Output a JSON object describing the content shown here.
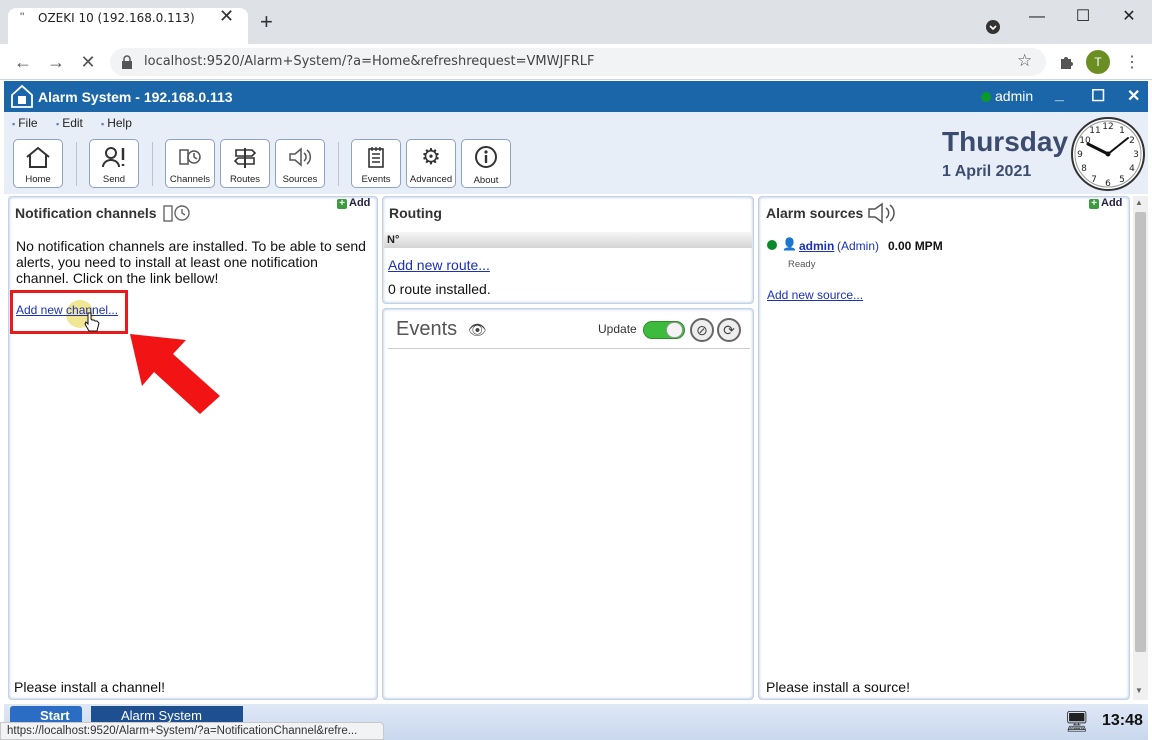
{
  "browser": {
    "tab_title": "OZEKI 10 (192.168.0.113)",
    "tab_favicon": "\"",
    "tab_close": "✕",
    "new_tab": "+",
    "url": "localhost:9520/Alarm+System/?a=Home&refreshrequest=VMWJFRLF",
    "profile_initial": "T",
    "status_url": "https://localhost:9520/Alarm+System/?a=NotificationChannel&refre..."
  },
  "app": {
    "title": "Alarm System - 192.168.0.113",
    "user": "admin",
    "menu": [
      "File",
      "Edit",
      "Help"
    ],
    "toolbar": [
      "Home",
      "Send",
      "Channels",
      "Routes",
      "Sources",
      "Events",
      "Advanced",
      "About"
    ],
    "day": "Thursday",
    "date": "1 April 2021"
  },
  "notification": {
    "title": "Notification channels",
    "add": "Add",
    "message": "No notification channels are installed. To be able to send alerts, you need to install at least one notification channel. Click on the link bellow!",
    "link": "Add new channel...",
    "footer": "Please install a channel!"
  },
  "routing": {
    "title": "Routing",
    "column": "N°",
    "link": "Add new route...",
    "count": "0 route installed."
  },
  "events": {
    "title": "Events",
    "update_label": "Update"
  },
  "sources": {
    "title": "Alarm sources",
    "add": "Add",
    "name": "admin",
    "role": "(Admin)",
    "rate": "0.00 MPM",
    "status": "Ready",
    "link": "Add new source...",
    "footer": "Please install a source!"
  },
  "taskbar": {
    "start": "Start",
    "app": "Alarm System",
    "time": "13:48"
  },
  "colors": {
    "header": "#1b66a9",
    "highlight": "#e81a1a",
    "toggle_on": "#3dbb3d"
  }
}
